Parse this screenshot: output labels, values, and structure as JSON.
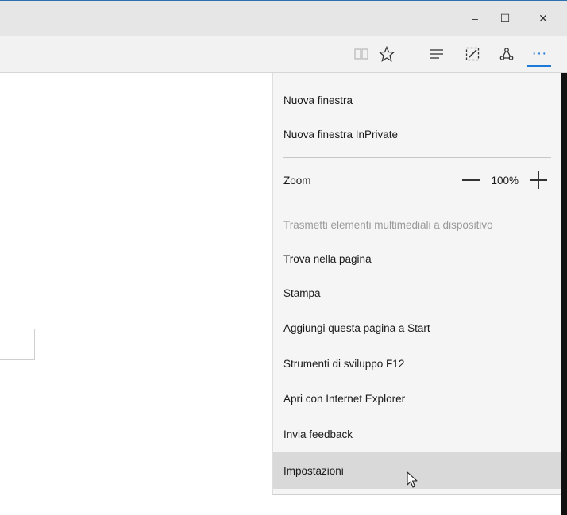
{
  "window_controls": {
    "minimize": "–",
    "maximize": "☐",
    "close": "✕"
  },
  "toolbar": {
    "reading_view_icon": "book-icon",
    "favorites_icon": "star-icon",
    "hub_icon": "hub-icon",
    "web_note_icon": "pen-note-icon",
    "share_icon": "share-icon",
    "more_label": "···"
  },
  "menu": {
    "new_window": "Nuova finestra",
    "new_inprivate": "Nuova finestra InPrivate",
    "zoom_label": "Zoom",
    "zoom_value": "100%",
    "cast": "Trasmetti elementi multimediali a dispositivo",
    "find": "Trova nella pagina",
    "print": "Stampa",
    "pin_start": "Aggiungi questa pagina a Start",
    "devtools": "Strumenti di sviluppo F12",
    "open_ie": "Apri con Internet Explorer",
    "feedback": "Invia feedback",
    "settings": "Impostazioni"
  },
  "colors": {
    "accent": "#1e7ad8",
    "menu_bg": "#f5f5f5",
    "hover_bg": "#d9d9d9"
  }
}
